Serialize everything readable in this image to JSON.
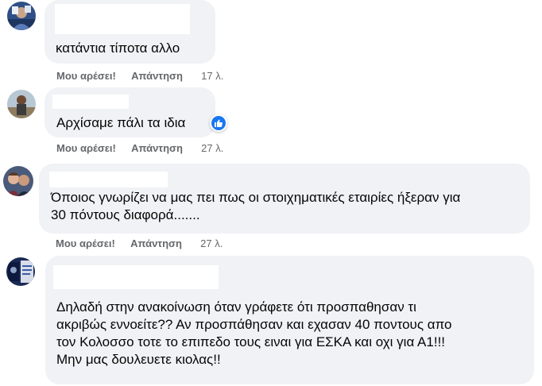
{
  "comments": [
    {
      "text": "κατάντια τίποτα αλλο",
      "like_label": "Μου αρέσει!",
      "reply_label": "Απάντηση",
      "time": "17 λ."
    },
    {
      "text": "Αρχίσαμε πάλι τα ιδια",
      "like_label": "Μου αρέσει!",
      "reply_label": "Απάντηση",
      "time": "27 λ.",
      "reaction_icon": "thumbs-up-icon",
      "reaction_color": "#1877f2"
    },
    {
      "text": "Όποιος γνωρίζει να μας πει πως οι στοιχηματικές εταιρίες ήξεραν για\n30 πόντους διαφορά.......",
      "like_label": "Μου αρέσει!",
      "reply_label": "Απάντηση",
      "time": "27 λ."
    },
    {
      "text": "Δηλαδή στην ανακοίνωση όταν γράφετε ότι προσπαθησαν τι\nακριβώς εννοείτε?? Αν προσπάθησαν και εχασαν 40 ποντους απο\nτον Κολοσσο τοτε το επιπεδο τους ειναι για ΕΣΚΑ και οχι για Α1!!!\nΜην μας δουλευετε κιολας!!"
    }
  ],
  "colors": {
    "bubble": "#f0f2f5",
    "meta_text": "#65676b",
    "body_text": "#050505"
  }
}
